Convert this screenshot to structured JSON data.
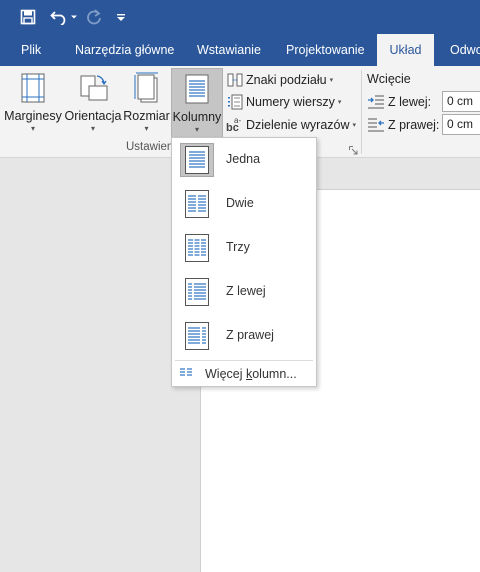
{
  "colors": {
    "accent": "#2b579a",
    "ribbon_bg": "#f3f3f3",
    "doc_bg": "#e6e6e6",
    "page_bg": "#ffffff",
    "pressed_bg": "#c5c5c5"
  },
  "quick_access": {
    "save_icon": "save-icon",
    "undo_icon": "undo-icon",
    "redo_icon": "redo-icon",
    "customize_icon": "customize-icon"
  },
  "tabs": [
    "Plik",
    "Narzędzia główne",
    "Wstawianie",
    "Projektowanie",
    "Układ",
    "Odwo"
  ],
  "active_tab": "Układ",
  "ribbon": {
    "page_setup": {
      "margins": "Marginesy",
      "orientation": "Orientacja",
      "size": "Rozmiar",
      "columns": "Kolumny",
      "breaks": "Znaki podziału",
      "line_numbers": "Numery wierszy",
      "hyphenation": "Dzielenie wyrazów",
      "group_label": "Ustawien"
    },
    "indent": {
      "title": "Wcięcie",
      "left_label": "Z lewej:",
      "left_value": "0 cm",
      "right_label": "Z prawej:",
      "right_value": "0 cm"
    }
  },
  "columns_menu": {
    "selected": "Jedna",
    "items": [
      {
        "label": "Jedna",
        "icon": "one-column-icon"
      },
      {
        "label": "Dwie",
        "icon": "two-columns-icon"
      },
      {
        "label": "Trzy",
        "icon": "three-columns-icon"
      },
      {
        "label": "Z lewej",
        "icon": "left-column-icon"
      },
      {
        "label": "Z prawej",
        "icon": "right-column-icon"
      }
    ],
    "more_prefix": "Więcej ",
    "more_underlined": "k",
    "more_suffix": "olumn..."
  }
}
